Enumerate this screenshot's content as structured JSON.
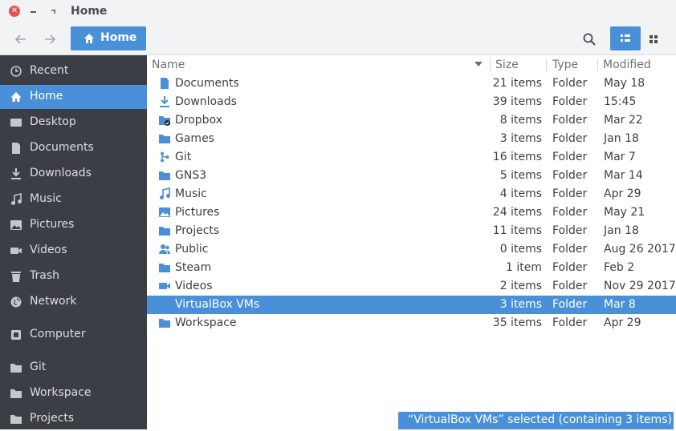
{
  "window": {
    "title": "Home"
  },
  "toolbar": {
    "path_label": "Home"
  },
  "colors": {
    "accent": "#4a90d9",
    "sidebar_bg": "#3b3e45",
    "folder": "#4a90d9"
  },
  "sidebar": {
    "items": [
      {
        "label": "Recent",
        "icon": "clock-icon"
      },
      {
        "label": "Home",
        "icon": "home-icon",
        "active": true
      },
      {
        "label": "Desktop",
        "icon": "desktop-icon"
      },
      {
        "label": "Documents",
        "icon": "document-icon"
      },
      {
        "label": "Downloads",
        "icon": "download-icon"
      },
      {
        "label": "Music",
        "icon": "music-icon"
      },
      {
        "label": "Pictures",
        "icon": "picture-icon"
      },
      {
        "label": "Videos",
        "icon": "video-icon"
      },
      {
        "label": "Trash",
        "icon": "trash-icon"
      },
      {
        "label": "Network",
        "icon": "network-icon"
      },
      {
        "label": "Computer",
        "icon": "computer-icon"
      },
      {
        "label": "Git",
        "icon": "folder-icon"
      },
      {
        "label": "Workspace",
        "icon": "folder-icon"
      },
      {
        "label": "Projects",
        "icon": "folder-icon"
      }
    ]
  },
  "columns": {
    "name": "Name",
    "size": "Size",
    "type": "Type",
    "modified": "Modified"
  },
  "files": [
    {
      "name": "Documents",
      "size": "21 items",
      "type": "Folder",
      "modified": "May 18",
      "icon": "document-folder-icon"
    },
    {
      "name": "Downloads",
      "size": "39 items",
      "type": "Folder",
      "modified": "15:45",
      "icon": "download-icon"
    },
    {
      "name": "Dropbox",
      "size": "8 items",
      "type": "Folder",
      "modified": "Mar 22",
      "icon": "dropbox-folder-icon"
    },
    {
      "name": "Games",
      "size": "3 items",
      "type": "Folder",
      "modified": "Jan 18",
      "icon": "folder-icon"
    },
    {
      "name": "Git",
      "size": "16 items",
      "type": "Folder",
      "modified": "Mar 7",
      "icon": "git-icon"
    },
    {
      "name": "GNS3",
      "size": "5 items",
      "type": "Folder",
      "modified": "Mar 14",
      "icon": "folder-icon"
    },
    {
      "name": "Music",
      "size": "4 items",
      "type": "Folder",
      "modified": "Apr 29",
      "icon": "music-icon"
    },
    {
      "name": "Pictures",
      "size": "24 items",
      "type": "Folder",
      "modified": "May 21",
      "icon": "picture-icon"
    },
    {
      "name": "Projects",
      "size": "11 items",
      "type": "Folder",
      "modified": "Jan 18",
      "icon": "folder-icon"
    },
    {
      "name": "Public",
      "size": "0 items",
      "type": "Folder",
      "modified": "Aug 26 2017",
      "icon": "public-icon"
    },
    {
      "name": "Steam",
      "size": "1 item",
      "type": "Folder",
      "modified": "Feb 2",
      "icon": "folder-icon"
    },
    {
      "name": "Videos",
      "size": "2 items",
      "type": "Folder",
      "modified": "Nov 29 2017",
      "icon": "video-icon"
    },
    {
      "name": "VirtualBox VMs",
      "size": "3 items",
      "type": "Folder",
      "modified": "Mar 8",
      "icon": "folder-icon",
      "selected": true
    },
    {
      "name": "Workspace",
      "size": "35 items",
      "type": "Folder",
      "modified": "Apr 29",
      "icon": "folder-icon"
    }
  ],
  "status": {
    "text": "“VirtualBox VMs” selected  (containing 3 items)"
  }
}
